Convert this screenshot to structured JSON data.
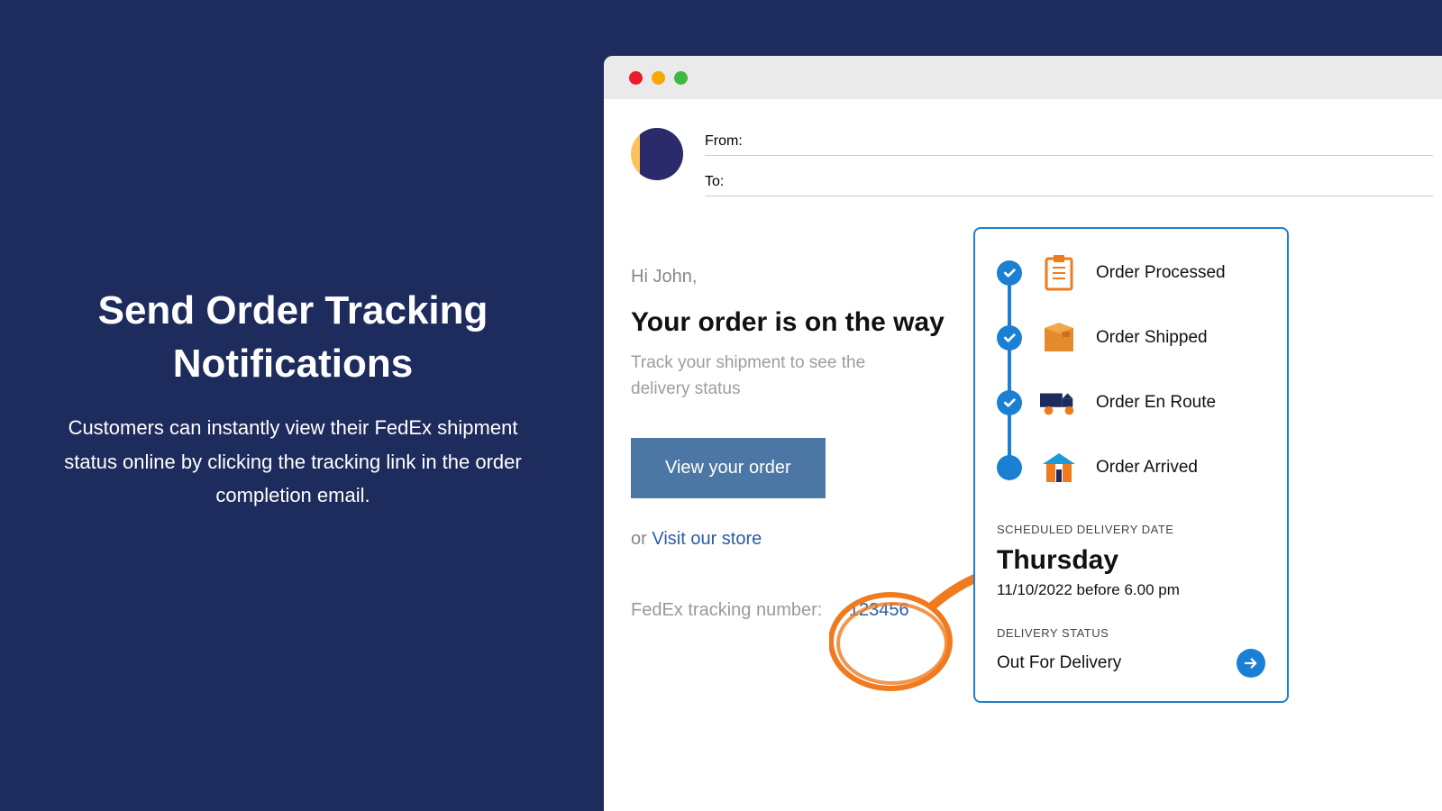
{
  "marketing": {
    "title": "Send Order Tracking Notifications",
    "body": "Customers can instantly view their FedEx shipment status online by clicking the tracking link in the order completion email."
  },
  "email": {
    "from_label": "From:",
    "to_label": "To:",
    "greeting": "Hi John,",
    "headline": "Your order is on the way",
    "sub": "Track your shipment to see the delivery status",
    "cta": "View your order",
    "or_prefix": "or ",
    "store_link": "Visit our store",
    "tracking_label": "FedEx tracking number:",
    "tracking_number": "123456"
  },
  "tracking": {
    "steps": [
      {
        "label": "Order Processed",
        "done": true
      },
      {
        "label": "Order Shipped",
        "done": true
      },
      {
        "label": "Order En Route",
        "done": true
      },
      {
        "label": "Order Arrived",
        "done": false
      }
    ],
    "scheduled_label": "SCHEDULED DELIVERY DATE",
    "scheduled_day": "Thursday",
    "scheduled_time": "11/10/2022 before 6.00 pm",
    "delivery_label": "DELIVERY STATUS",
    "delivery_status": "Out For Delivery"
  }
}
